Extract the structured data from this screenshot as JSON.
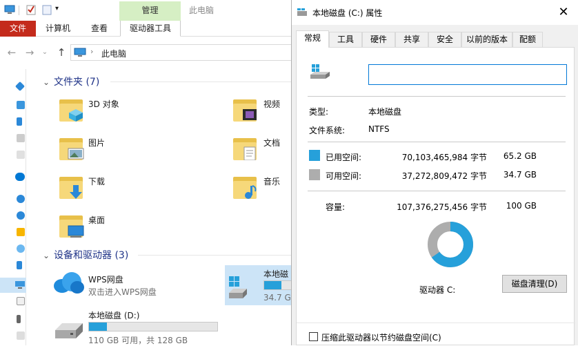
{
  "explorer": {
    "ribbon": {
      "context_group": "管理",
      "breadcrumb_title": "此电脑",
      "tabs": [
        "文件",
        "计算机",
        "查看",
        "驱动器工具"
      ]
    },
    "address": {
      "path": "此电脑"
    },
    "folders_section": {
      "title": "文件夹 (7)"
    },
    "folders": [
      {
        "name": "3D 对象",
        "icon": "3d-objects-folder-icon"
      },
      {
        "name": "视频",
        "icon": "videos-folder-icon"
      },
      {
        "name": "图片",
        "icon": "pictures-folder-icon"
      },
      {
        "name": "文档",
        "icon": "documents-folder-icon"
      },
      {
        "name": "下载",
        "icon": "downloads-folder-icon"
      },
      {
        "name": "音乐",
        "icon": "music-folder-icon"
      },
      {
        "name": "桌面",
        "icon": "desktop-folder-icon"
      }
    ],
    "devices_section": {
      "title": "设备和驱动器 (3)"
    },
    "devices": [
      {
        "name": "WPS网盘",
        "sub": "双击进入WPS网盘",
        "icon": "wps-cloud-icon"
      },
      {
        "name": "本地磁盘",
        "sub": "34.7 G",
        "icon": "windows-drive-icon",
        "used_fraction": 0.653
      },
      {
        "name": "本地磁盘 (D:)",
        "sub": "110 GB 可用，共 128 GB",
        "icon": "drive-icon",
        "used_fraction": 0.14
      }
    ]
  },
  "dialog": {
    "title": "本地磁盘 (C:) 属性",
    "tabs": [
      "常规",
      "工具",
      "硬件",
      "共享",
      "安全",
      "以前的版本",
      "配额"
    ],
    "active_tab": "常规",
    "name_value": "",
    "type_label": "类型:",
    "type_value": "本地磁盘",
    "fs_label": "文件系统:",
    "fs_value": "NTFS",
    "used": {
      "label": "已用空间:",
      "bytes": "70,103,465,984 字节",
      "size": "65.2 GB",
      "color": "#26a0da"
    },
    "free": {
      "label": "可用空间:",
      "bytes": "37,272,809,472 字节",
      "size": "34.7 GB",
      "color": "#adadad"
    },
    "capacity": {
      "label": "容量:",
      "bytes": "107,376,275,456 字节",
      "size": "100 GB"
    },
    "drive_label": "驱动器 C:",
    "cleanup_button": "磁盘清理(D)",
    "compress_checkbox": "压缩此驱动器以节约磁盘空间(C)",
    "used_fraction": 0.653
  },
  "colors": {
    "accent": "#0078d7",
    "used": "#26a0da",
    "free": "#adadad",
    "context_tab": "#d6efc4",
    "file_tab": "#c42b1c"
  }
}
